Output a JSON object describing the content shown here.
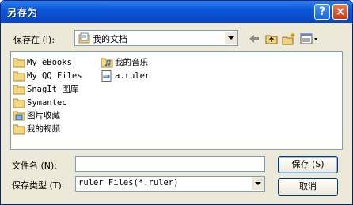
{
  "window": {
    "title": "另存为"
  },
  "title_buttons": {
    "help": "?",
    "close": "×"
  },
  "save_in": {
    "label": "保存在 (I):",
    "value": "我的文档"
  },
  "items": [
    {
      "label": "My eBooks",
      "icon": "folder"
    },
    {
      "label": "My QQ Files",
      "icon": "folder"
    },
    {
      "label": "SnagIt 图库",
      "icon": "folder"
    },
    {
      "label": "Symantec",
      "icon": "folder"
    },
    {
      "label": "图片收藏",
      "icon": "pictures-folder"
    },
    {
      "label": "我的视频",
      "icon": "folder"
    },
    {
      "label": "我的音乐",
      "icon": "music-folder"
    },
    {
      "label": "a.ruler",
      "icon": "ruler-file"
    }
  ],
  "file_name": {
    "label": "文件名 (N):",
    "value": ""
  },
  "file_type": {
    "label": "保存类型 (T):",
    "value": "ruler Files(*.ruler)"
  },
  "buttons": {
    "save": "保存 (S)",
    "cancel": "取消"
  }
}
